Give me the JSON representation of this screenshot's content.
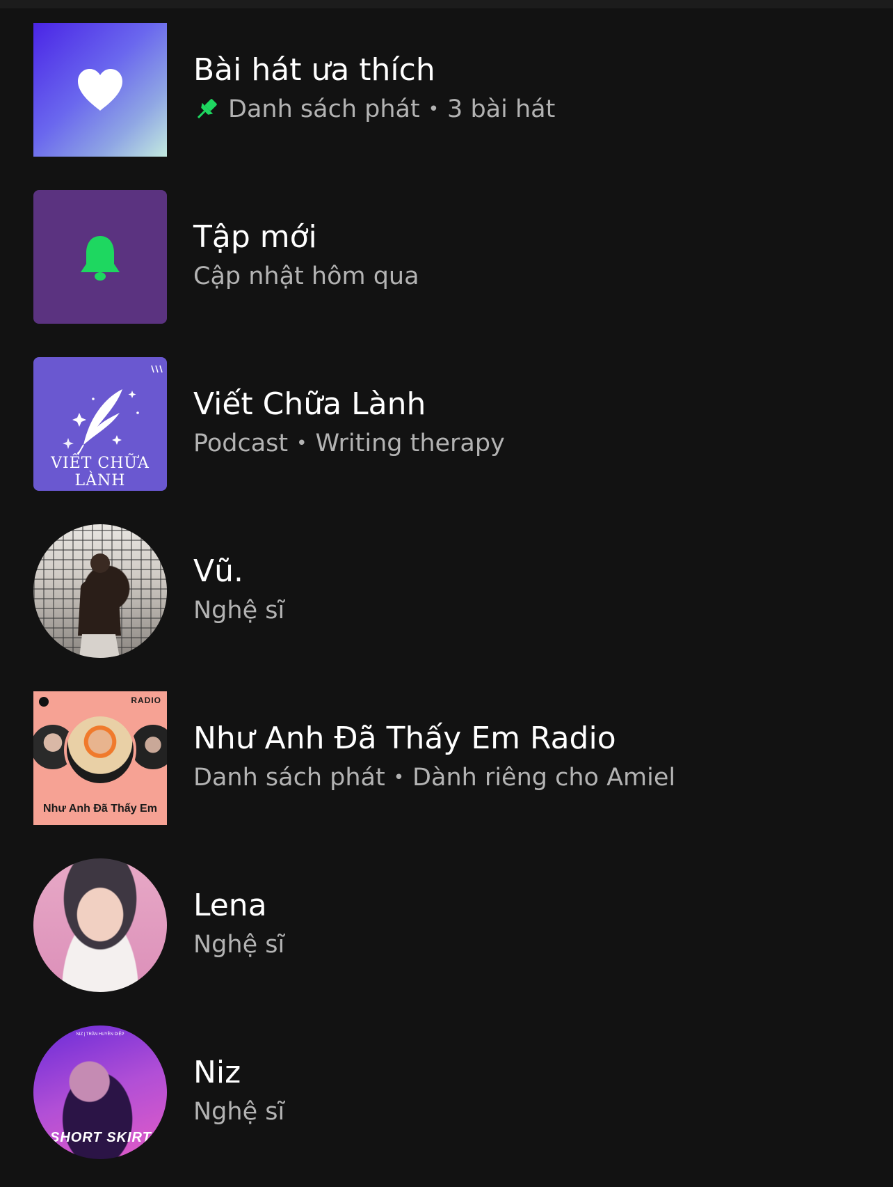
{
  "library": {
    "items": [
      {
        "title": "Bài hát ưa thích",
        "subtitle_type": "Danh sách phát",
        "subtitle_detail": "3 bài hát",
        "pinned": true,
        "art_icon": "heart-icon",
        "accent": "#1ed760"
      },
      {
        "title": "Tập mới",
        "subtitle": "Cập nhật hôm qua",
        "art_icon": "bell-icon",
        "accent": "#1ed760"
      },
      {
        "title": "Viết Chữa Lành",
        "subtitle_type": "Podcast",
        "subtitle_detail": "Writing therapy",
        "cover_text": "VIẾT CHỮA LÀNH"
      },
      {
        "title": "Vũ.",
        "subtitle": "Nghệ sĩ"
      },
      {
        "title": "Như Anh Đã Thấy Em Radio",
        "subtitle_type": "Danh sách phát",
        "subtitle_detail": "Dành riêng cho Amiel",
        "cover_label": "RADIO",
        "cover_title": "Như Anh Đã Thấy Em"
      },
      {
        "title": "Lena",
        "subtitle": "Nghệ sĩ"
      },
      {
        "title": "Niz",
        "subtitle": "Nghệ sĩ",
        "cover_top": "NIZ | TRẦN HUYỀN DIỆP",
        "cover_text": "SHORT SKIRT"
      }
    ]
  },
  "separator": "•",
  "colors": {
    "background": "#121212",
    "primary_text": "#ffffff",
    "secondary_text": "#b3b3b3",
    "spotify_green": "#1ed760"
  }
}
